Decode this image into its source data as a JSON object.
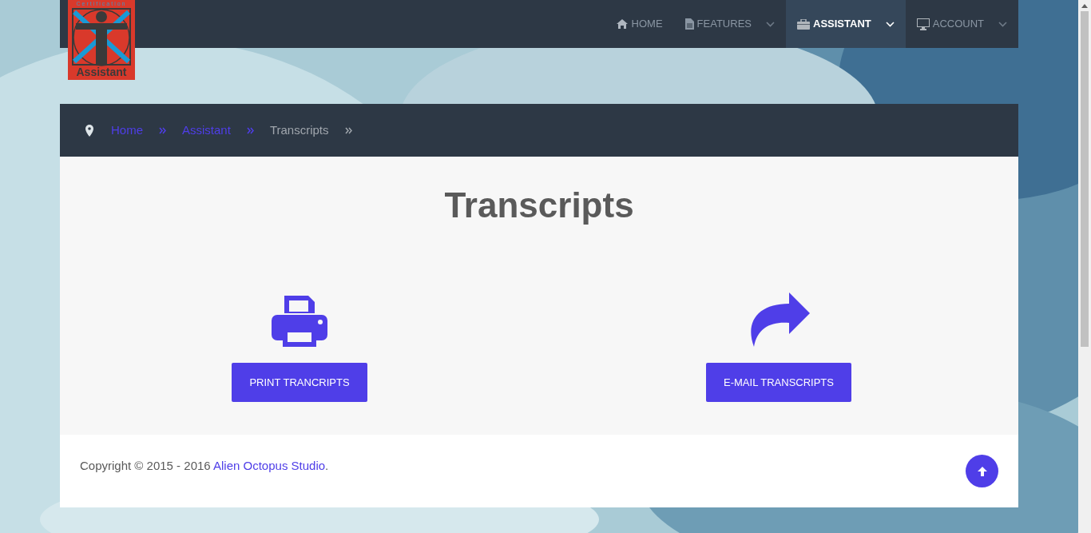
{
  "logo": {
    "top_text": "Certification",
    "bottom_text": "Assistant"
  },
  "nav": [
    {
      "label": "HOME",
      "dropdown": false,
      "selected": false
    },
    {
      "label": "FEATURES",
      "dropdown": true,
      "selected": false
    },
    {
      "label": "ASSISTANT",
      "dropdown": true,
      "selected": true
    },
    {
      "label": "ACCOUNT",
      "dropdown": true,
      "selected": false
    }
  ],
  "breadcrumb": [
    {
      "label": "Home",
      "kind": "link"
    },
    {
      "label": "Assistant",
      "kind": "link"
    },
    {
      "label": "Transcripts",
      "kind": "current"
    }
  ],
  "title": "Transcripts",
  "actions": [
    {
      "label": "PRINT TRANCRIPTS",
      "kind": "print"
    },
    {
      "label": "E-MAIL TRANSCRIPTS",
      "kind": "email"
    }
  ],
  "footer": {
    "text": "Copyright © 2015 - 2016 ",
    "link": "Alien Octopus Studio",
    "after": "."
  }
}
